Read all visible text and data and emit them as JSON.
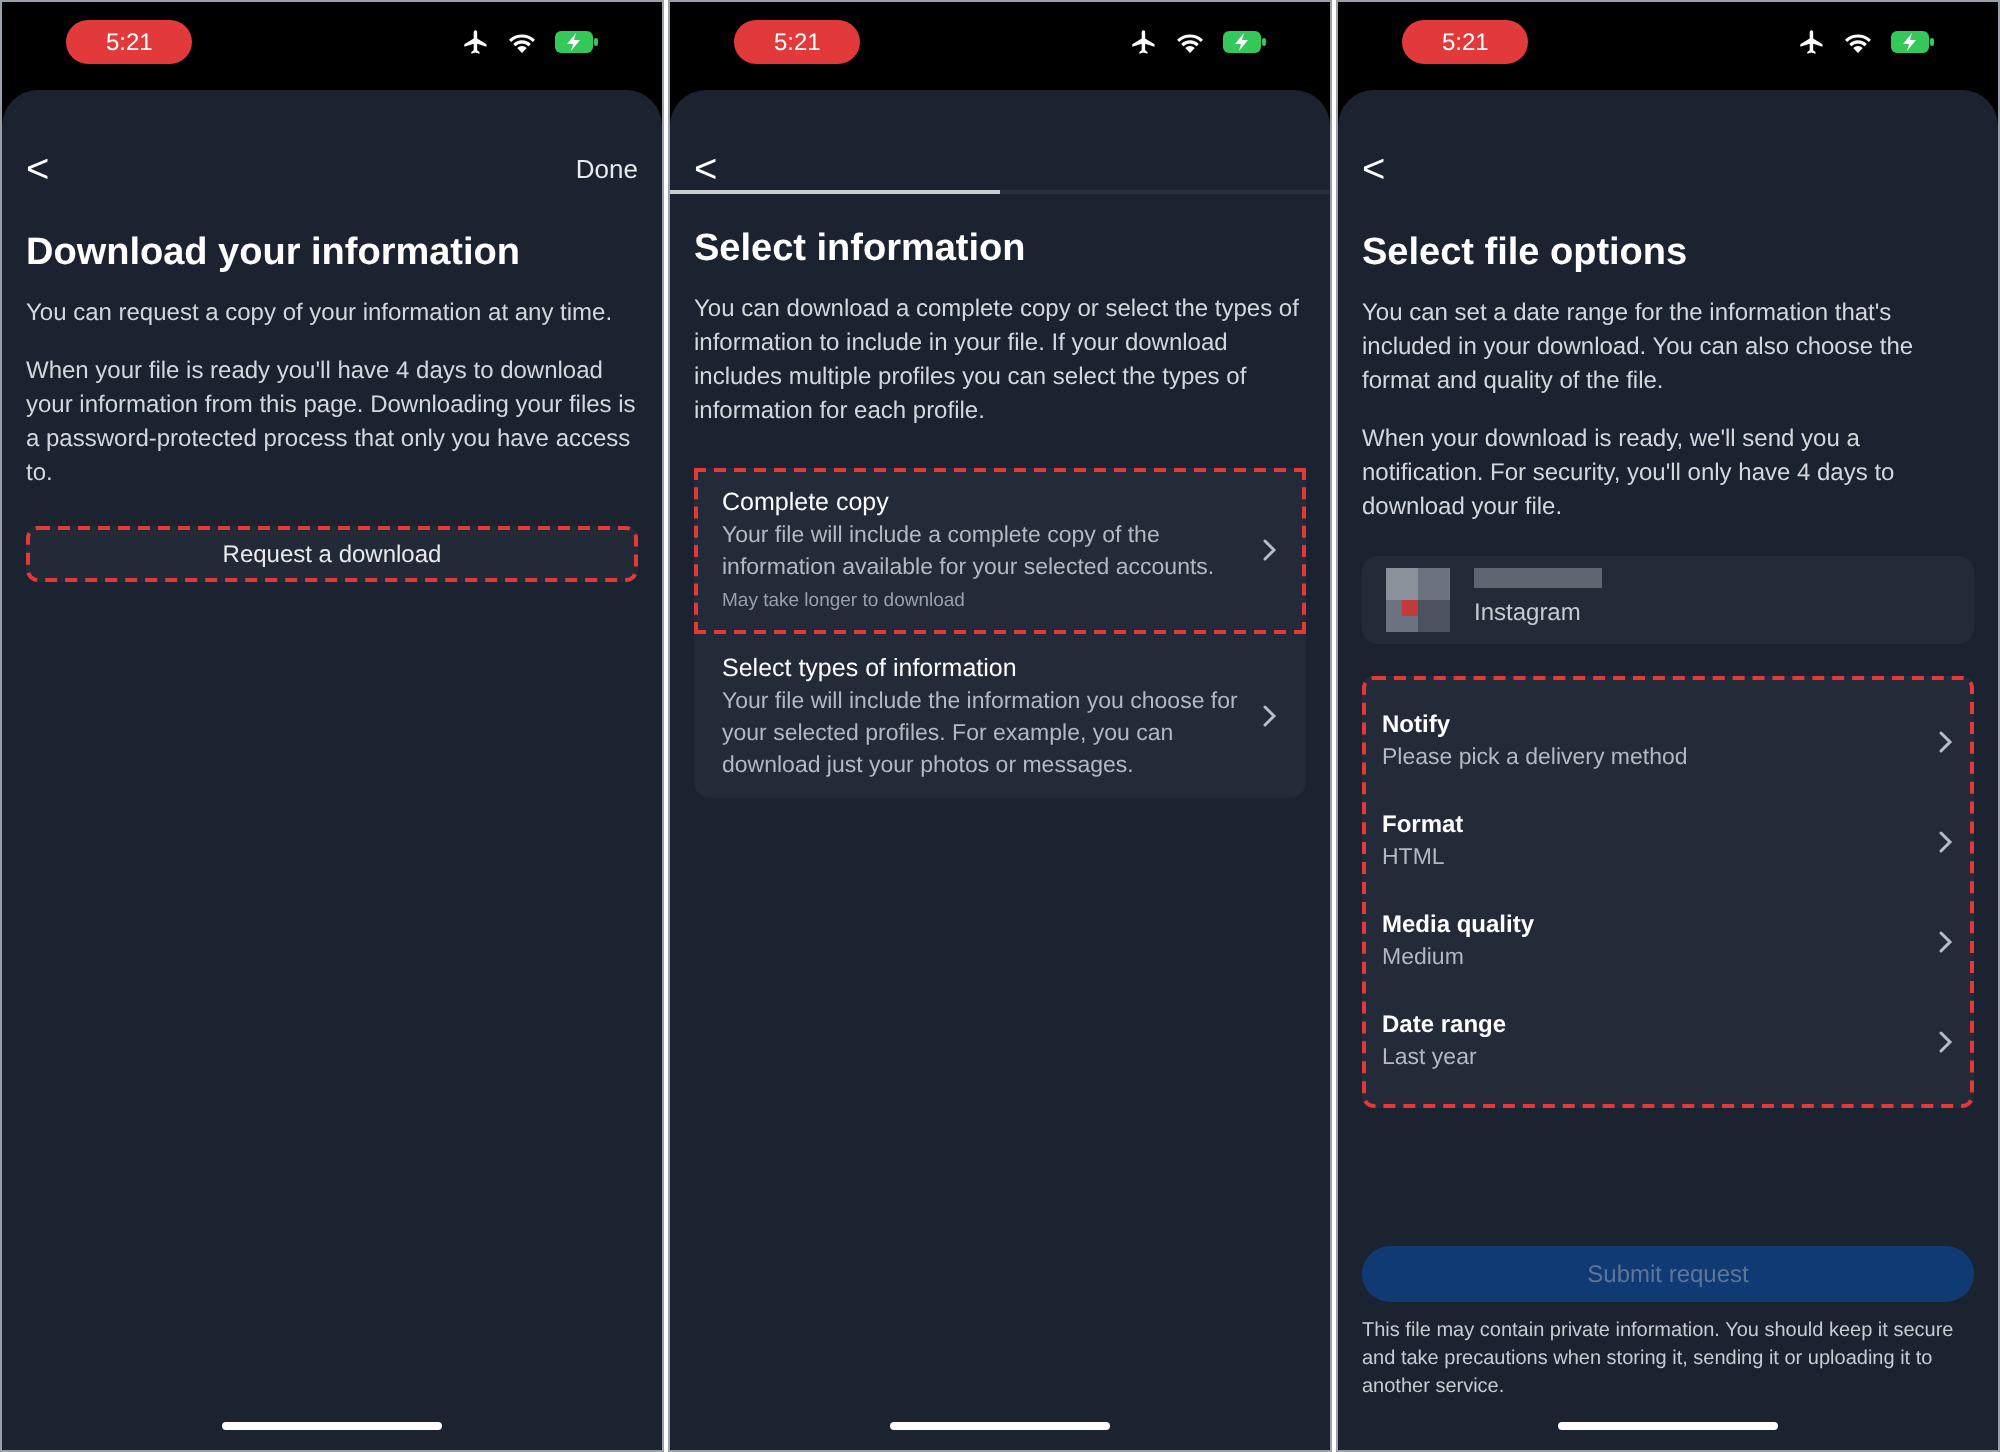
{
  "screens": [
    {
      "status": {
        "time": "5:21"
      },
      "nav": {
        "back": "<",
        "action": "Done"
      },
      "title": "Download your information",
      "paragraphs": [
        "You can request a copy of your information at any time.",
        "When your file is ready you'll have 4 days to download your information from this page. Downloading your files is a password-protected process that only you have access to."
      ],
      "button": {
        "label": "Request a download",
        "highlighted": true
      }
    },
    {
      "status": {
        "time": "5:21"
      },
      "nav": {
        "back": "<"
      },
      "progress": {
        "level": 0.5
      },
      "title": "Select information",
      "paragraphs": [
        "You can download a complete copy or select the types of information to include in your file. If your download includes multiple profiles you can select the types of information for each profile."
      ],
      "options": [
        {
          "title": "Complete copy",
          "description": "Your file will include a complete copy of the information available for your selected accounts.",
          "note": "May take longer to download",
          "highlighted": true
        },
        {
          "title": "Select types of information",
          "description": "Your file will include the information you choose for your selected profiles. For example, you can download just your photos or messages.",
          "highlighted": false
        }
      ]
    },
    {
      "status": {
        "time": "5:21"
      },
      "nav": {
        "back": "<"
      },
      "title": "Select file options",
      "paragraphs": [
        "You can set a date range for the information that's included in your download. You can also choose the format and quality of the file.",
        "When your download is ready, we'll send you a notification. For security, you'll only have 4 days to download your file."
      ],
      "account": {
        "platform": "Instagram"
      },
      "settings": {
        "highlighted": true,
        "rows": [
          {
            "label": "Notify",
            "value": "Please pick a delivery method"
          },
          {
            "label": "Format",
            "value": "HTML"
          },
          {
            "label": "Media quality",
            "value": "Medium"
          },
          {
            "label": "Date range",
            "value": "Last year"
          }
        ]
      },
      "submit": {
        "label": "Submit request",
        "disabled": true
      },
      "footnote": "This file may contain private information. You should keep it secure and take precautions when storing it, sending it or uploading it to another service."
    }
  ]
}
